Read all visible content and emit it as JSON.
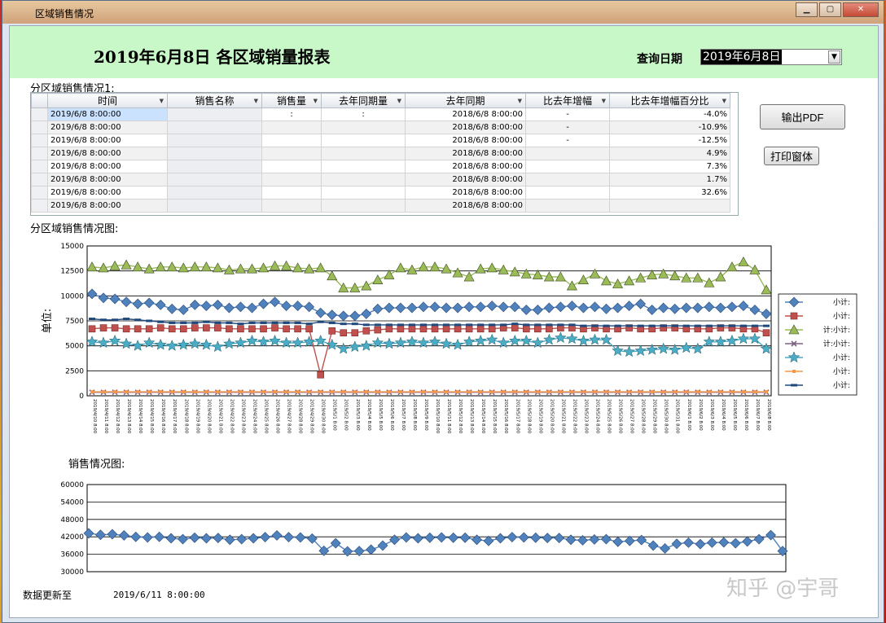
{
  "window": {
    "title": "区域销售情况"
  },
  "header": {
    "report_title": "2019年6月8日  各区域销量报表",
    "query_label": "查询日期",
    "query_date": "2019年6月8日"
  },
  "grid": {
    "section_label": "分区域销售情况1:",
    "columns": [
      "时间",
      "销售名称",
      "销售量",
      "去年同期量",
      "去年同期",
      "比去年增幅",
      "比去年增幅百分比"
    ],
    "rows": [
      [
        "2019/6/8 8:00:00",
        "",
        ":",
        ":",
        "2018/6/8 8:00:00",
        "-",
        "-4.0%"
      ],
      [
        "2019/6/8 8:00:00",
        "",
        "",
        "",
        "2018/6/8 8:00:00",
        "-",
        "-10.9%"
      ],
      [
        "2019/6/8 8:00:00",
        "",
        "",
        "",
        "2018/6/8 8:00:00",
        "-",
        "-12.5%"
      ],
      [
        "2019/6/8 8:00:00",
        "",
        "",
        "",
        "2018/6/8 8:00:00",
        "",
        "4.9%"
      ],
      [
        "2019/6/8 8:00:00",
        "",
        "",
        "",
        "2018/6/8 8:00:00",
        "",
        "7.3%"
      ],
      [
        "2019/6/8 8:00:00",
        "",
        "",
        "",
        "2018/6/8 8:00:00",
        "",
        "1.7%"
      ],
      [
        "2019/6/8 8:00:00",
        "",
        "",
        "",
        "2018/6/8 8:00:00",
        "",
        "32.6%"
      ],
      [
        "2019/6/8 8:00:00",
        "",
        "",
        "",
        "2018/6/8 8:00:00",
        "",
        ""
      ]
    ]
  },
  "buttons": {
    "export_pdf": "输出PDF",
    "print_form": "打印窗体"
  },
  "chart1": {
    "section_label": "分区域销售情况图:",
    "ylabel": "单位:",
    "legend": [
      "小计:",
      "小计:",
      "计:小计:",
      "计:小计:",
      "小计:",
      "小计:",
      "小计:"
    ]
  },
  "chart2": {
    "section_label": "销售情况图:"
  },
  "footer": {
    "label": "数据更新至",
    "value": "2019/6/11 8:00:00"
  },
  "watermark": "知乎 @宇哥",
  "colors": {
    "header_bg": "#c8f7c8",
    "selected_row": "#cbe2ff"
  },
  "chart_data": [
    {
      "type": "line",
      "title": "",
      "ylabel": "单位:",
      "ylim": [
        0,
        15000
      ],
      "yticks": [
        0,
        2500,
        5000,
        7500,
        10000,
        12500,
        15000
      ],
      "xlabels": [
        "2019/4/10 8:00",
        "2019/4/11 8:00",
        "2019/4/12 8:00",
        "2019/4/13 8:00",
        "2019/4/14 8:00",
        "2019/4/15 8:00",
        "2019/4/16 8:00",
        "2019/4/17 8:00",
        "2019/4/18 8:00",
        "2019/4/19 8:00",
        "2019/4/20 8:00",
        "2019/4/21 8:00",
        "2019/4/22 8:00",
        "2019/4/23 8:00",
        "2019/4/24 8:00",
        "2019/4/25 8:00",
        "2019/4/26 8:00",
        "2019/4/27 8:00",
        "2019/4/28 8:00",
        "2019/4/29 8:00",
        "2019/4/30 8:00",
        "2019/5/1 8:00",
        "2019/5/2 8:00",
        "2019/5/3 8:00",
        "2019/5/4 8:00",
        "2019/5/5 8:00",
        "2019/5/6 8:00",
        "2019/5/7 8:00",
        "2019/5/8 8:00",
        "2019/5/9 8:00",
        "2019/5/10 8:00",
        "2019/5/11 8:00",
        "2019/5/12 8:00",
        "2019/5/13 8:00",
        "2019/5/14 8:00",
        "2019/5/15 8:00",
        "2019/5/16 8:00",
        "2019/5/17 8:00",
        "2019/5/18 8:00",
        "2019/5/19 8:00",
        "2019/5/20 8:00",
        "2019/5/21 8:00",
        "2019/5/22 8:00",
        "2019/5/23 8:00",
        "2019/5/24 8:00",
        "2019/5/25 8:00",
        "2019/5/26 8:00",
        "2019/5/27 8:00",
        "2019/5/28 8:00",
        "2019/5/29 8:00",
        "2019/5/30 8:00",
        "2019/5/31 8:00",
        "2019/6/1 8:00",
        "2019/6/2 8:00",
        "2019/6/3 8:00",
        "2019/6/4 8:00",
        "2019/6/5 8:00",
        "2019/6/6 8:00",
        "2019/6/7 8:00",
        "2019/6/8 8:00"
      ],
      "series": [
        {
          "name": "小计:",
          "marker": "diamond",
          "color": "#4f81bd",
          "values": [
            10200,
            9800,
            9700,
            9400,
            9200,
            9300,
            9100,
            8700,
            8600,
            9100,
            9000,
            9100,
            8800,
            8900,
            8800,
            9200,
            9400,
            9000,
            9000,
            8900,
            8300,
            8100,
            8000,
            8000,
            8200,
            8700,
            8800,
            8800,
            8800,
            8900,
            8900,
            8800,
            8800,
            8900,
            8900,
            9000,
            8900,
            8900,
            8600,
            8600,
            8800,
            8900,
            9000,
            8800,
            8900,
            8700,
            8800,
            9000,
            9200,
            8600,
            8800,
            8700,
            8800,
            8800,
            8900,
            8800,
            8900,
            9000,
            8600,
            8200
          ]
        },
        {
          "name": "小计:",
          "marker": "square",
          "color": "#c0504d",
          "values": [
            6700,
            6800,
            6800,
            6700,
            6700,
            6700,
            6800,
            6700,
            6700,
            6800,
            6800,
            6800,
            6700,
            6700,
            6700,
            6700,
            6800,
            6700,
            6700,
            6700,
            2100,
            6500,
            6300,
            6300,
            6500,
            6600,
            6700,
            6700,
            6700,
            6700,
            6700,
            6700,
            6700,
            6700,
            6700,
            6700,
            6800,
            6800,
            6700,
            6700,
            6700,
            6800,
            6800,
            6700,
            6800,
            6700,
            6700,
            6800,
            6700,
            6700,
            6800,
            6800,
            6700,
            6700,
            6700,
            6800,
            6800,
            6700,
            6700,
            6300
          ]
        },
        {
          "name": "计:小计:",
          "marker": "triangle",
          "color": "#9bbb59",
          "values": [
            12900,
            12800,
            13000,
            13100,
            12900,
            12700,
            12900,
            12900,
            12800,
            12900,
            12900,
            12800,
            12600,
            12700,
            12700,
            12800,
            13000,
            13000,
            12800,
            12700,
            12800,
            12000,
            10800,
            10800,
            11000,
            11600,
            12100,
            12800,
            12600,
            12900,
            12900,
            12700,
            12300,
            11900,
            12700,
            12800,
            12600,
            12400,
            12200,
            12100,
            11900,
            11900,
            11000,
            11600,
            12200,
            11500,
            11200,
            11500,
            11800,
            12100,
            12200,
            12000,
            11800,
            11800,
            11300,
            11900,
            12900,
            13400,
            12600,
            10600
          ]
        },
        {
          "name": "计:小计:",
          "marker": "x",
          "color": "#7f6084",
          "values": [
            350,
            350,
            350,
            350,
            350,
            350,
            350,
            350,
            350,
            350,
            350,
            350,
            350,
            350,
            350,
            350,
            350,
            350,
            350,
            350,
            350,
            350,
            350,
            350,
            350,
            350,
            350,
            350,
            350,
            350,
            350,
            350,
            350,
            350,
            350,
            350,
            350,
            350,
            350,
            350,
            350,
            350,
            350,
            350,
            350,
            350,
            350,
            350,
            350,
            350,
            350,
            350,
            350,
            350,
            350,
            350,
            350,
            350,
            350,
            350
          ]
        },
        {
          "name": "小计:",
          "marker": "star",
          "color": "#4bacc6",
          "values": [
            5400,
            5300,
            5500,
            5200,
            5000,
            5300,
            5100,
            5000,
            5100,
            5200,
            5100,
            4900,
            5200,
            5300,
            5500,
            5400,
            5500,
            5300,
            5300,
            5400,
            5500,
            5100,
            4700,
            4900,
            5000,
            5300,
            5200,
            5300,
            5400,
            5300,
            5400,
            5200,
            5100,
            5400,
            5500,
            5600,
            5300,
            5500,
            5500,
            5300,
            5600,
            5800,
            5700,
            5500,
            5600,
            5600,
            4500,
            4400,
            4500,
            4600,
            4700,
            4600,
            4800,
            4700,
            5400,
            5400,
            5500,
            5700,
            5700,
            4700
          ]
        },
        {
          "name": "小计:",
          "marker": "square-small",
          "color": "#f79646",
          "values": [
            400,
            400,
            400,
            400,
            400,
            400,
            400,
            400,
            400,
            400,
            400,
            400,
            400,
            400,
            400,
            400,
            400,
            400,
            400,
            400,
            400,
            400,
            400,
            400,
            400,
            400,
            400,
            400,
            400,
            400,
            400,
            400,
            400,
            400,
            400,
            400,
            400,
            400,
            400,
            400,
            400,
            400,
            400,
            400,
            400,
            400,
            400,
            400,
            400,
            400,
            400,
            400,
            400,
            400,
            400,
            400,
            400,
            400,
            400,
            400
          ]
        },
        {
          "name": "小计:",
          "marker": "dash",
          "color": "#1f497d",
          "values": [
            7700,
            7600,
            7600,
            7700,
            7600,
            7500,
            7400,
            7300,
            7300,
            7300,
            7400,
            7300,
            7300,
            7200,
            7300,
            7300,
            7300,
            7300,
            7300,
            7200,
            7400,
            7300,
            7200,
            7200,
            7100,
            7100,
            7100,
            7100,
            7100,
            7100,
            7100,
            7100,
            7100,
            7100,
            7100,
            7100,
            7100,
            7200,
            7100,
            7100,
            7100,
            7100,
            7100,
            7000,
            7000,
            7000,
            7000,
            7000,
            7000,
            7000,
            7000,
            7000,
            7000,
            7000,
            7000,
            7000,
            7000,
            7000,
            7000,
            7000
          ]
        }
      ],
      "grid": true,
      "legend_position": "right"
    },
    {
      "type": "line",
      "title": "",
      "ylim": [
        30000,
        60000
      ],
      "yticks": [
        30000,
        36000,
        42000,
        48000,
        54000,
        60000
      ],
      "series": [
        {
          "marker": "diamond",
          "color": "#4f81bd",
          "values": [
            43200,
            42700,
            42900,
            42500,
            42000,
            41800,
            42000,
            41500,
            41200,
            41700,
            41500,
            41600,
            41000,
            41200,
            41500,
            41900,
            42500,
            41900,
            41800,
            41400,
            37200,
            39800,
            37000,
            37100,
            37600,
            39000,
            41000,
            41800,
            41500,
            41700,
            41800,
            41700,
            41700,
            41000,
            40600,
            41500,
            41900,
            41800,
            41700,
            41600,
            41600,
            41000,
            40800,
            41100,
            41200,
            40300,
            40600,
            40900,
            39000,
            38000,
            39600,
            40000,
            39500,
            40000,
            40100,
            39800,
            40400,
            41200,
            42600,
            37100
          ]
        }
      ],
      "grid": true
    }
  ]
}
